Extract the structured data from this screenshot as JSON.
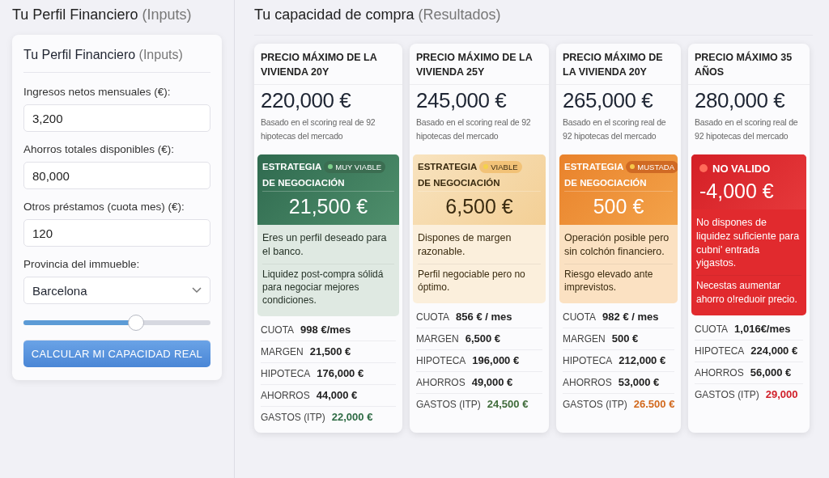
{
  "inputs_header": {
    "title": "Tu Perfil Financiero",
    "suffix": "(Inputs)"
  },
  "form": {
    "title": "Tu Perfil Financiero",
    "suffix": "(Inputs)",
    "fields": [
      {
        "kind": "text",
        "label": "Ingresos netos mensuales (€):",
        "value": "3,200"
      },
      {
        "kind": "text",
        "label": "Ahorros totales disponibles (€):",
        "value": "80,000"
      },
      {
        "kind": "text",
        "label": "Otros préstamos (cuota mes) (€):",
        "value": "120"
      },
      {
        "kind": "select",
        "label": "Provincia del immueble:",
        "value": "Barcelona"
      }
    ],
    "slider": {
      "level": 0.6
    },
    "button": "CALCULAR MI CAPACIDAD REAL"
  },
  "results_header": {
    "title": "Tu capacidad de compra",
    "suffix": "(Resultados)"
  },
  "cards": [
    {
      "title": "PRECIO MÁXIMO DE LA VIVIENDA 20Y",
      "price": "220,000 €",
      "note": "Basado en el scoring real de 92 hipotecas del mercado",
      "strategy": {
        "kind": "green",
        "title": "ESTRATEGIA",
        "subtitle": "DE NEGOCIACIÓN",
        "badge": "MUY VIABLE",
        "amount": "21,500 €",
        "paragraphs": [
          "Eres un perfil deseado para el banco.",
          "Liquidez post-compra sólidá para negociar mejores condiciones."
        ]
      },
      "stats": [
        {
          "label": "CUOTA",
          "value": "998 €/mes"
        },
        {
          "label": "MARGEN",
          "value": "21,500 €"
        },
        {
          "label": "HIPOTECA",
          "value": "176,000 €"
        },
        {
          "label": "AHORROS",
          "value": "44,000 €"
        },
        {
          "label": "GASTOS (ITP)",
          "value": "22,000 €",
          "color": "#2e6b45"
        }
      ]
    },
    {
      "title": "PRECIO MÁXIMO DE LA VIVIENDA 25Y",
      "price": "245,000 €",
      "note": "Basado en el scoring real de 92 hipotecas del mercado",
      "strategy": {
        "kind": "amber",
        "title": "ESTRATEGIA",
        "subtitle": "DE NEGOCIACIÓN",
        "badge": "VIABLE",
        "amount": "6,500 €",
        "paragraphs": [
          "Dispones de margen razonable.",
          "Perfil negociable pero no óptimo."
        ]
      },
      "stats": [
        {
          "label": "CUOTA",
          "value": "856 € / mes"
        },
        {
          "label": "MARGEN",
          "value": "6,500 €"
        },
        {
          "label": "HIPOTECA",
          "value": "196,000 €"
        },
        {
          "label": "AHORROS",
          "value": "49,000 €"
        },
        {
          "label": "GASTOS (ITP)",
          "value": "24,500 €",
          "color": "#3f6b3a"
        }
      ]
    },
    {
      "title": "PRECIO MÁXIMO DE LA VIVIENDA 20Y",
      "price": "265,000 €",
      "note": "Basado en el scoring real de 92 hipotecas del mercado",
      "strategy": {
        "kind": "orange",
        "title": "ESTRATEGIA",
        "subtitle": "DE NEGOCIACIÓN",
        "badge": "MUSTADA",
        "amount": "500 €",
        "paragraphs": [
          "Operación posible pero sin colchón financiero.",
          "Riesgo elevado ante imprevistos."
        ]
      },
      "stats": [
        {
          "label": "CUOTA",
          "value": "982 € / mes"
        },
        {
          "label": "MARGEN",
          "value": "500 €"
        },
        {
          "label": "HIPOTECA",
          "value": "212,000 €"
        },
        {
          "label": "AHORROS",
          "value": "53,000 €"
        },
        {
          "label": "GASTOS (ITP)",
          "value": "26.500 €",
          "color": "#d2691e"
        }
      ]
    },
    {
      "title": "PRECIO MÁXIMO 35 AÑOS",
      "price": "280,000 €",
      "note": "Basado en el scoring real de 92 hipotecas del mercado",
      "strategy": {
        "kind": "red",
        "badge": "NO VALIDO",
        "amount": "-4,000 €",
        "paragraphs": [
          "No dispones de liquidez suficiente para cubni' entrada yigastos.",
          "Necestas aumentar ahorro o!reduoir precio."
        ]
      },
      "stats": [
        {
          "label": "CUOTA",
          "value": "1,016€/mes"
        },
        {
          "label": "HIPOTECA",
          "value": "224,000 €"
        },
        {
          "label": "AHORROS",
          "value": "56,000 €"
        },
        {
          "label": "GASTOS (ITP)",
          "value": "29,000",
          "color": "#d0202a"
        }
      ]
    }
  ]
}
